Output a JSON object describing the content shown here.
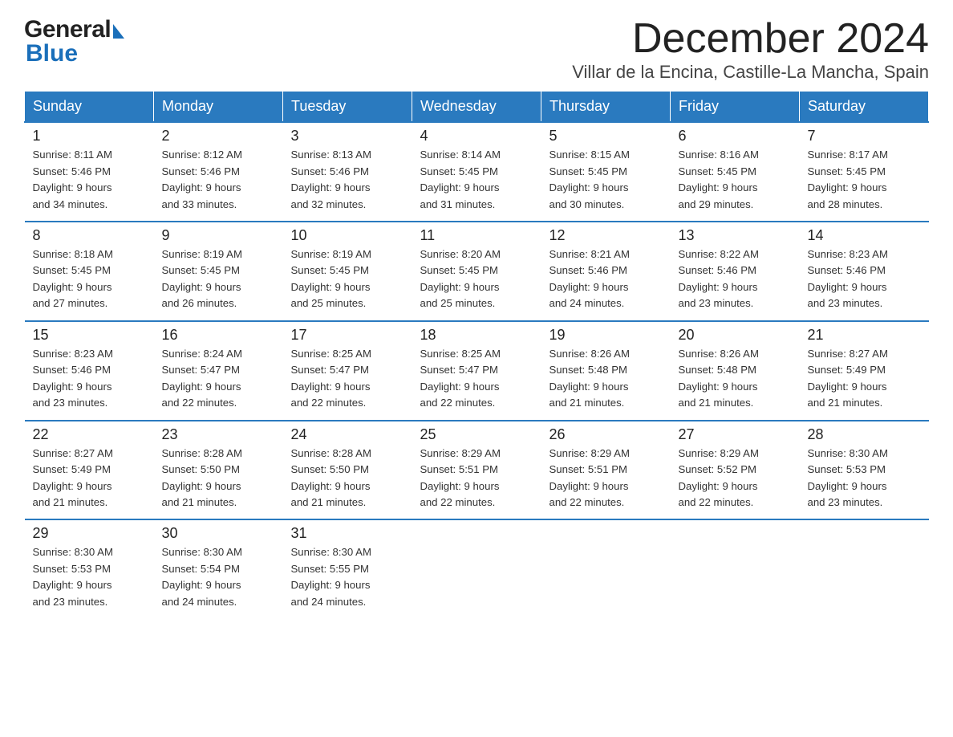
{
  "header": {
    "logo_general": "General",
    "logo_blue": "Blue",
    "month_title": "December 2024",
    "location": "Villar de la Encina, Castille-La Mancha, Spain"
  },
  "days_of_week": [
    "Sunday",
    "Monday",
    "Tuesday",
    "Wednesday",
    "Thursday",
    "Friday",
    "Saturday"
  ],
  "weeks": [
    [
      {
        "day": "1",
        "sunrise": "8:11 AM",
        "sunset": "5:46 PM",
        "daylight": "9 hours and 34 minutes."
      },
      {
        "day": "2",
        "sunrise": "8:12 AM",
        "sunset": "5:46 PM",
        "daylight": "9 hours and 33 minutes."
      },
      {
        "day": "3",
        "sunrise": "8:13 AM",
        "sunset": "5:46 PM",
        "daylight": "9 hours and 32 minutes."
      },
      {
        "day": "4",
        "sunrise": "8:14 AM",
        "sunset": "5:45 PM",
        "daylight": "9 hours and 31 minutes."
      },
      {
        "day": "5",
        "sunrise": "8:15 AM",
        "sunset": "5:45 PM",
        "daylight": "9 hours and 30 minutes."
      },
      {
        "day": "6",
        "sunrise": "8:16 AM",
        "sunset": "5:45 PM",
        "daylight": "9 hours and 29 minutes."
      },
      {
        "day": "7",
        "sunrise": "8:17 AM",
        "sunset": "5:45 PM",
        "daylight": "9 hours and 28 minutes."
      }
    ],
    [
      {
        "day": "8",
        "sunrise": "8:18 AM",
        "sunset": "5:45 PM",
        "daylight": "9 hours and 27 minutes."
      },
      {
        "day": "9",
        "sunrise": "8:19 AM",
        "sunset": "5:45 PM",
        "daylight": "9 hours and 26 minutes."
      },
      {
        "day": "10",
        "sunrise": "8:19 AM",
        "sunset": "5:45 PM",
        "daylight": "9 hours and 25 minutes."
      },
      {
        "day": "11",
        "sunrise": "8:20 AM",
        "sunset": "5:45 PM",
        "daylight": "9 hours and 25 minutes."
      },
      {
        "day": "12",
        "sunrise": "8:21 AM",
        "sunset": "5:46 PM",
        "daylight": "9 hours and 24 minutes."
      },
      {
        "day": "13",
        "sunrise": "8:22 AM",
        "sunset": "5:46 PM",
        "daylight": "9 hours and 23 minutes."
      },
      {
        "day": "14",
        "sunrise": "8:23 AM",
        "sunset": "5:46 PM",
        "daylight": "9 hours and 23 minutes."
      }
    ],
    [
      {
        "day": "15",
        "sunrise": "8:23 AM",
        "sunset": "5:46 PM",
        "daylight": "9 hours and 23 minutes."
      },
      {
        "day": "16",
        "sunrise": "8:24 AM",
        "sunset": "5:47 PM",
        "daylight": "9 hours and 22 minutes."
      },
      {
        "day": "17",
        "sunrise": "8:25 AM",
        "sunset": "5:47 PM",
        "daylight": "9 hours and 22 minutes."
      },
      {
        "day": "18",
        "sunrise": "8:25 AM",
        "sunset": "5:47 PM",
        "daylight": "9 hours and 22 minutes."
      },
      {
        "day": "19",
        "sunrise": "8:26 AM",
        "sunset": "5:48 PM",
        "daylight": "9 hours and 21 minutes."
      },
      {
        "day": "20",
        "sunrise": "8:26 AM",
        "sunset": "5:48 PM",
        "daylight": "9 hours and 21 minutes."
      },
      {
        "day": "21",
        "sunrise": "8:27 AM",
        "sunset": "5:49 PM",
        "daylight": "9 hours and 21 minutes."
      }
    ],
    [
      {
        "day": "22",
        "sunrise": "8:27 AM",
        "sunset": "5:49 PM",
        "daylight": "9 hours and 21 minutes."
      },
      {
        "day": "23",
        "sunrise": "8:28 AM",
        "sunset": "5:50 PM",
        "daylight": "9 hours and 21 minutes."
      },
      {
        "day": "24",
        "sunrise": "8:28 AM",
        "sunset": "5:50 PM",
        "daylight": "9 hours and 21 minutes."
      },
      {
        "day": "25",
        "sunrise": "8:29 AM",
        "sunset": "5:51 PM",
        "daylight": "9 hours and 22 minutes."
      },
      {
        "day": "26",
        "sunrise": "8:29 AM",
        "sunset": "5:51 PM",
        "daylight": "9 hours and 22 minutes."
      },
      {
        "day": "27",
        "sunrise": "8:29 AM",
        "sunset": "5:52 PM",
        "daylight": "9 hours and 22 minutes."
      },
      {
        "day": "28",
        "sunrise": "8:30 AM",
        "sunset": "5:53 PM",
        "daylight": "9 hours and 23 minutes."
      }
    ],
    [
      {
        "day": "29",
        "sunrise": "8:30 AM",
        "sunset": "5:53 PM",
        "daylight": "9 hours and 23 minutes."
      },
      {
        "day": "30",
        "sunrise": "8:30 AM",
        "sunset": "5:54 PM",
        "daylight": "9 hours and 24 minutes."
      },
      {
        "day": "31",
        "sunrise": "8:30 AM",
        "sunset": "5:55 PM",
        "daylight": "9 hours and 24 minutes."
      },
      null,
      null,
      null,
      null
    ]
  ],
  "labels": {
    "sunrise": "Sunrise:",
    "sunset": "Sunset:",
    "daylight": "Daylight:"
  }
}
